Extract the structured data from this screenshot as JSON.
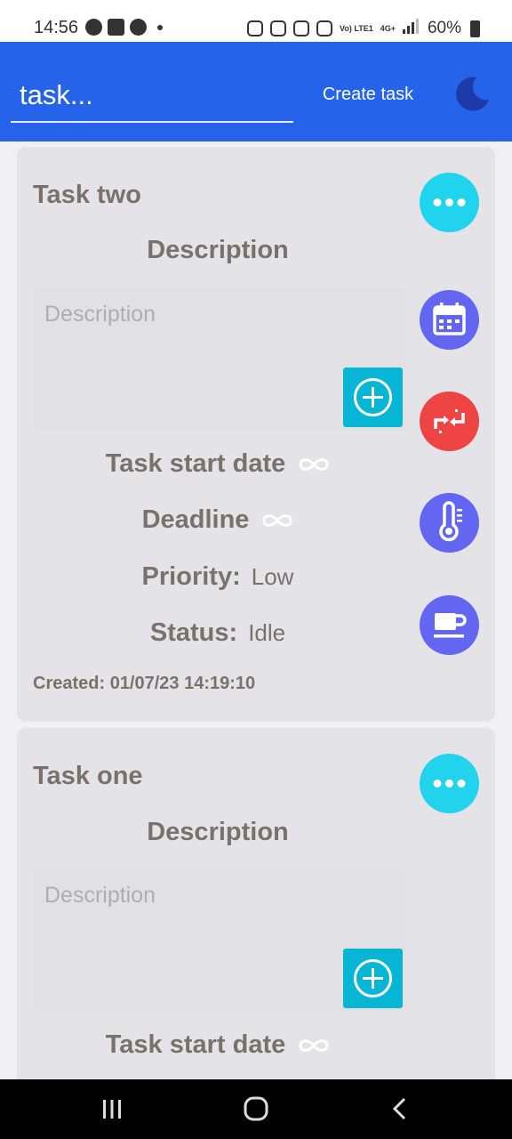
{
  "status_bar": {
    "time": "14:56",
    "left_icons": [
      "alert-icon",
      "image-icon",
      "account-icon",
      "dot-icon"
    ],
    "network_label": "Vo) LTE1",
    "network_type": "4G+",
    "battery": "60%"
  },
  "app_bar": {
    "input_placeholder": "task...",
    "create_label": "Create task",
    "theme_icon": "moon-icon",
    "background": "#2563eb"
  },
  "cards": [
    {
      "title": "Task two",
      "description_heading": "Description",
      "description_placeholder": "Description",
      "start_date_label": "Task start date",
      "start_date_value_icon": "infinity-icon",
      "deadline_label": "Deadline",
      "deadline_value_icon": "infinity-icon",
      "priority_label": "Priority:",
      "priority_value": "Low",
      "status_label": "Status:",
      "status_value": "Idle",
      "created": "Created: 01/07/23 14:19:10",
      "action_icons": [
        "more-icon",
        "calendar-icon",
        "swap-icon",
        "thermometer-icon",
        "coffee-icon"
      ]
    },
    {
      "title": "Task one",
      "description_heading": "Description",
      "description_placeholder": "Description",
      "start_date_label": "Task start date",
      "start_date_value_icon": "infinity-icon",
      "action_icons": [
        "more-icon"
      ]
    }
  ],
  "colors": {
    "accent": "#2563eb",
    "cyan": "#22d3ee",
    "indigo": "#6366f1",
    "red": "#ef4444",
    "add_button": "#06b6d4",
    "card_text": "#7a716a"
  }
}
